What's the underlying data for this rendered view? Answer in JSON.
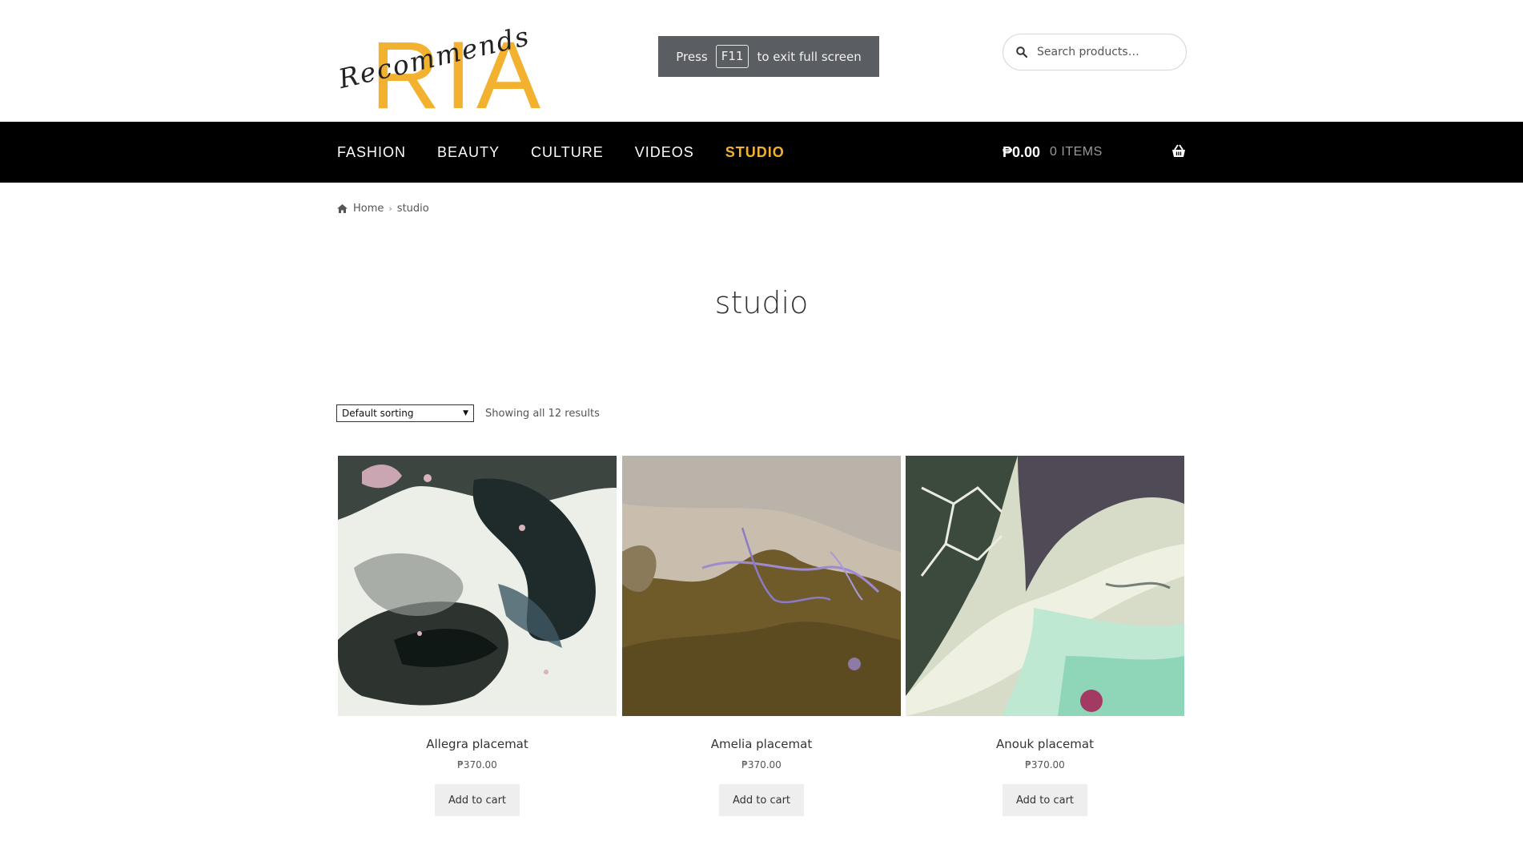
{
  "header": {
    "logo_text": "RIA",
    "logo_script": "Recommends",
    "fullscreen_notice": {
      "press": "Press",
      "key": "F11",
      "suffix": "to exit full screen"
    },
    "search": {
      "placeholder": "Search products…"
    }
  },
  "nav": {
    "items": [
      {
        "label": "FASHION"
      },
      {
        "label": "BEAUTY"
      },
      {
        "label": "CULTURE"
      },
      {
        "label": "VIDEOS"
      },
      {
        "label": "STUDIO"
      }
    ],
    "active": "STUDIO",
    "cart": {
      "amount": "₱0.00",
      "items": "0 ITEMS"
    }
  },
  "breadcrumb": {
    "home": "Home",
    "current": "studio"
  },
  "page_title": "studio",
  "toolbar": {
    "sort_selected": "Default sorting",
    "results": "Showing all 12 results"
  },
  "products": [
    {
      "name": "Allegra placemat",
      "price": "₱370.00",
      "button": "Add to cart"
    },
    {
      "name": "Amelia placemat",
      "price": "₱370.00",
      "button": "Add to cart"
    },
    {
      "name": "Anouk placemat",
      "price": "₱370.00",
      "button": "Add to cart"
    }
  ],
  "colors": {
    "accent": "#f2b230",
    "nav_bg": "#000000",
    "notice_bg": "#5a5d62"
  }
}
